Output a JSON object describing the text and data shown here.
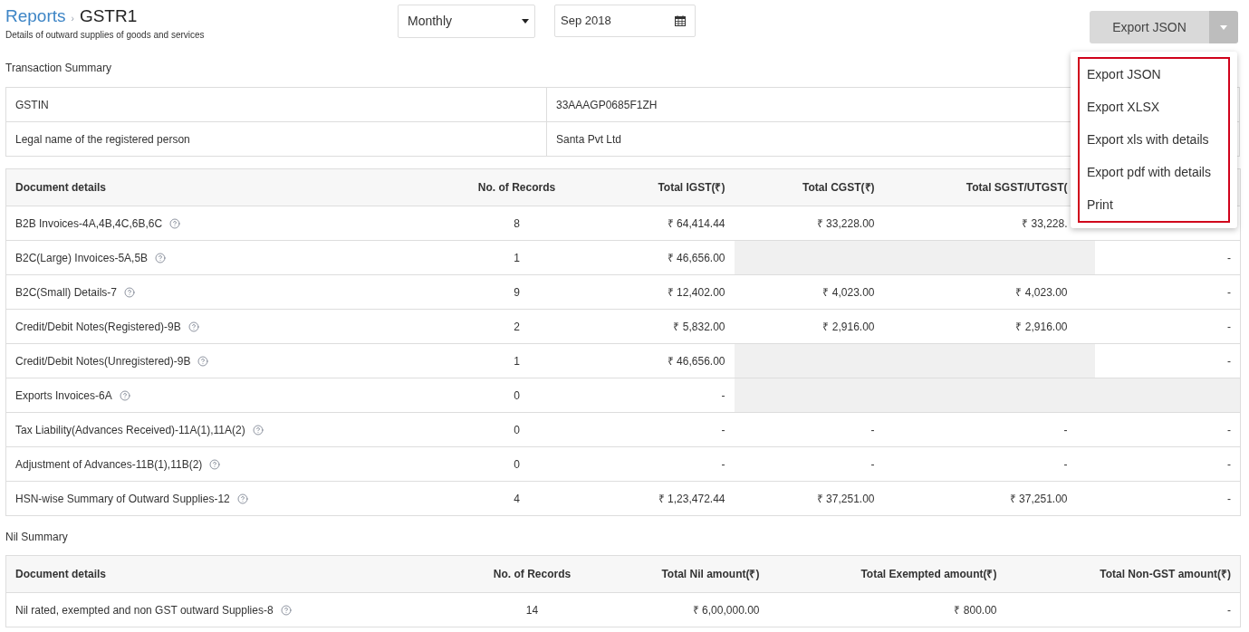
{
  "header": {
    "breadcrumb": "Reports",
    "separator": "›",
    "title": "GSTR1",
    "subtitle": "Details of outward supplies of goods and services"
  },
  "period_select": {
    "value": "Monthly"
  },
  "date_field": {
    "value": "Sep 2018"
  },
  "export_button": {
    "label": "Export JSON"
  },
  "export_menu": {
    "items": [
      "Export JSON",
      "Export XLSX",
      "Export xls with details",
      "Export pdf with details",
      "Print"
    ]
  },
  "transaction_summary": {
    "title": "Transaction Summary",
    "rows": [
      {
        "label": "GSTIN",
        "value": "33AAAGP0685F1ZH"
      },
      {
        "label": "Legal name of the registered person",
        "value": "Santa Pvt Ltd"
      }
    ]
  },
  "document_table": {
    "columns": [
      "Document details",
      "No. of Records",
      "Total IGST(₹)",
      "Total CGST(₹)",
      "Total SGST/UTGST("
    ],
    "rows": [
      {
        "cells": [
          {
            "kind": "label",
            "text": "B2B Invoices-4A,4B,4C,6B,6C"
          },
          {
            "kind": "text",
            "text": "8"
          },
          {
            "kind": "text",
            "text": "₹ 64,414.44"
          },
          {
            "kind": "text",
            "text": "₹ 33,228.00"
          },
          {
            "kind": "text",
            "text": "₹ 33,228."
          }
        ]
      },
      {
        "cells": [
          {
            "kind": "label",
            "text": "B2C(Large) Invoices-5A,5B"
          },
          {
            "kind": "text",
            "text": "1"
          },
          {
            "kind": "text",
            "text": "₹ 46,656.00"
          },
          {
            "kind": "blank"
          },
          {
            "kind": "blank"
          },
          {
            "kind": "text",
            "text": "-"
          }
        ]
      },
      {
        "cells": [
          {
            "kind": "label",
            "text": "B2C(Small) Details-7"
          },
          {
            "kind": "text",
            "text": "9"
          },
          {
            "kind": "text",
            "text": "₹ 12,402.00"
          },
          {
            "kind": "text",
            "text": "₹ 4,023.00"
          },
          {
            "kind": "text",
            "text": "₹ 4,023.00"
          },
          {
            "kind": "text",
            "text": "-"
          }
        ]
      },
      {
        "cells": [
          {
            "kind": "label",
            "text": "Credit/Debit Notes(Registered)-9B"
          },
          {
            "kind": "text",
            "text": "2"
          },
          {
            "kind": "text",
            "text": "₹ 5,832.00"
          },
          {
            "kind": "text",
            "text": "₹ 2,916.00"
          },
          {
            "kind": "text",
            "text": "₹ 2,916.00"
          },
          {
            "kind": "text",
            "text": "-"
          }
        ]
      },
      {
        "cells": [
          {
            "kind": "label",
            "text": "Credit/Debit Notes(Unregistered)-9B"
          },
          {
            "kind": "text",
            "text": "1"
          },
          {
            "kind": "text",
            "text": "₹ 46,656.00"
          },
          {
            "kind": "blank"
          },
          {
            "kind": "blank"
          },
          {
            "kind": "text",
            "text": "-"
          }
        ]
      },
      {
        "cells": [
          {
            "kind": "label",
            "text": "Exports Invoices-6A"
          },
          {
            "kind": "text",
            "text": "0"
          },
          {
            "kind": "text",
            "text": "-"
          },
          {
            "kind": "blank"
          },
          {
            "kind": "blank"
          },
          {
            "kind": "blank"
          }
        ]
      },
      {
        "cells": [
          {
            "kind": "label",
            "text": "Tax Liability(Advances Received)-11A(1),11A(2)"
          },
          {
            "kind": "text",
            "text": "0"
          },
          {
            "kind": "text",
            "text": "-"
          },
          {
            "kind": "text",
            "text": "-"
          },
          {
            "kind": "text",
            "text": "-"
          },
          {
            "kind": "text",
            "text": "-"
          }
        ]
      },
      {
        "cells": [
          {
            "kind": "label",
            "text": "Adjustment of Advances-11B(1),11B(2)"
          },
          {
            "kind": "text",
            "text": "0"
          },
          {
            "kind": "text",
            "text": "-"
          },
          {
            "kind": "text",
            "text": "-"
          },
          {
            "kind": "text",
            "text": "-"
          },
          {
            "kind": "text",
            "text": "-"
          }
        ]
      },
      {
        "cells": [
          {
            "kind": "label",
            "text": "HSN-wise Summary of Outward Supplies-12"
          },
          {
            "kind": "text",
            "text": "4"
          },
          {
            "kind": "text",
            "text": "₹ 1,23,472.44"
          },
          {
            "kind": "text",
            "text": "₹ 37,251.00"
          },
          {
            "kind": "text",
            "text": "₹ 37,251.00"
          },
          {
            "kind": "text",
            "text": "-"
          }
        ]
      }
    ]
  },
  "nil_summary": {
    "title": "Nil Summary",
    "columns": [
      "Document details",
      "No. of Records",
      "Total Nil amount(₹)",
      "Total Exempted amount(₹)",
      "Total Non-GST amount(₹)"
    ],
    "rows": [
      {
        "cells": [
          "Nil rated, exempted and non GST outward Supplies-8",
          "14",
          "₹ 6,00,000.00",
          "₹ 800.00",
          "-"
        ]
      }
    ]
  }
}
